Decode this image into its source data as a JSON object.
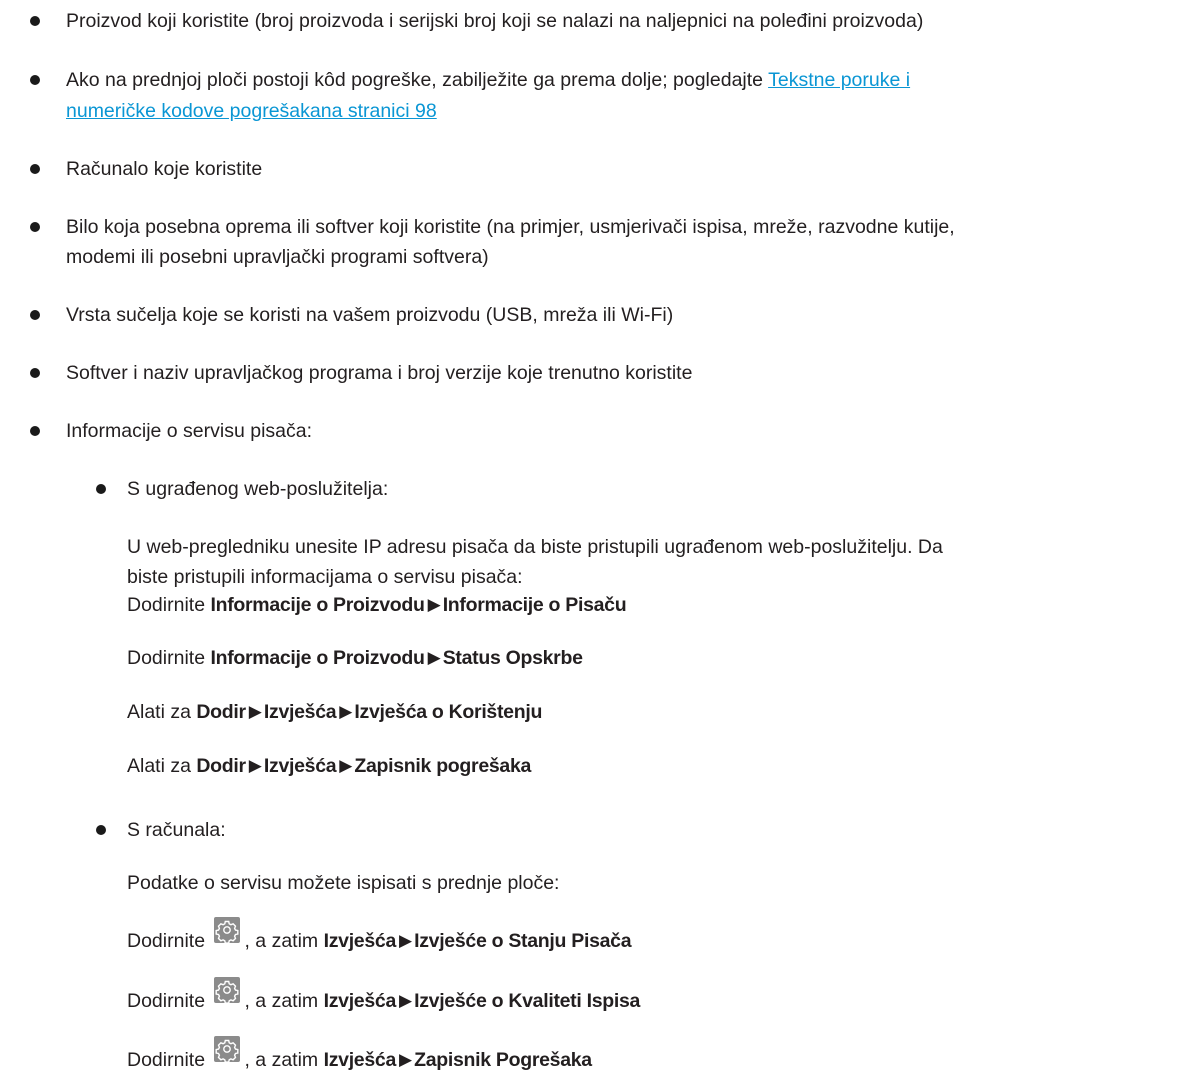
{
  "list": {
    "item1": "Proizvod koji koristite (broj proizvoda i serijski broj koji se nalazi na naljepnici na poleđini proizvoda)",
    "item2_text": "Ako na prednjoj ploči postoji kôd pogreške, zabilježite ga prema dolje; pogledajte ",
    "item2_link_line1": "Tekstne poruke i",
    "item2_link_line2": "numeričke kodove pogrešakana stranici 98",
    "item3": "Računalo koje koristite",
    "item4_line1": "Bilo koja posebna oprema ili softver koji koristite (na primjer, usmjerivači ispisa, mreže, razvodne kutije,",
    "item4_line2": "modemi ili posebni upravljački programi softvera)",
    "item5": "Vrsta sučelja koje se koristi na vašem proizvodu (USB, mreža ili Wi-Fi)",
    "item6": "Softver i naziv upravljačkog programa i broj verzije koje trenutno koristite",
    "item7": "Informacije o servisu pisača:"
  },
  "ews": {
    "heading": "S ugrađenog web-poslužitelja:",
    "intro_line1": "U web-pregledniku unesite IP adresu pisača da biste pristupili ugrađenom web-poslužitelju. Da",
    "intro_line2": "biste pristupili informacijama o servisu pisača:",
    "step1": {
      "prefix": "Dodirnite ",
      "a": "Informacije o Proizvodu",
      "b": "Informacije o Pisaču"
    },
    "step2": {
      "prefix": "Dodirnite ",
      "a": "Informacije o Proizvodu",
      "b": "Status Opskrbe"
    },
    "step3": {
      "prefix": "Alati za ",
      "a": "Dodir",
      "b": "Izvješća",
      "c": "Izvješća o Korištenju"
    },
    "step4": {
      "prefix": "Alati za ",
      "a": "Dodir",
      "b": "Izvješća",
      "c": "Zapisnik pogrešaka"
    }
  },
  "computer": {
    "heading": "S računala:",
    "intro": "Podatke o servisu možete ispisati s prednje ploče:",
    "step_prefix": "Dodirnite ",
    "step_mid": ", a zatim ",
    "step1": {
      "a": "Izvješća",
      "b": "Izvješće o Stanju Pisača"
    },
    "step2": {
      "a": "Izvješća",
      "b": "Izvješće o Kvaliteti Ispisa"
    },
    "step3": {
      "a": "Izvješća",
      "b": "Zapisnik Pogrešaka"
    }
  },
  "symbols": {
    "arrow": "▶",
    "settings_icon": "gear-icon",
    "link_color": "#0a96d4"
  }
}
